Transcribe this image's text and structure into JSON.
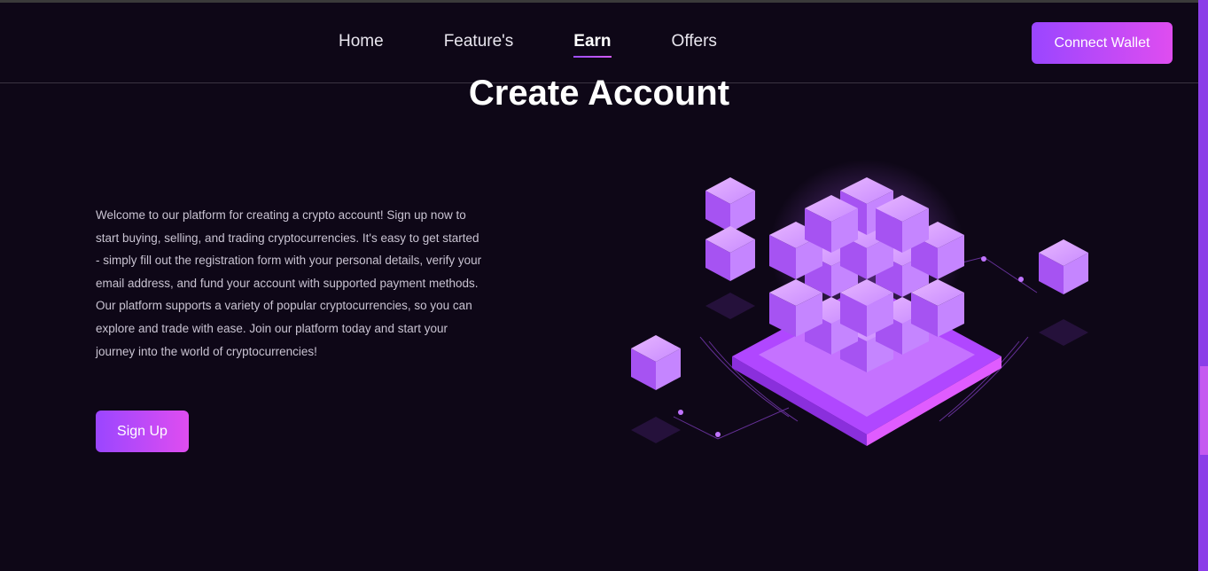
{
  "nav": {
    "links": [
      {
        "label": "Home"
      },
      {
        "label": "Feature's"
      },
      {
        "label": "Earn"
      },
      {
        "label": "Offers"
      }
    ],
    "active": "Earn",
    "connect_label": "Connect Wallet"
  },
  "hero": {
    "title": "Create Account",
    "description": "Welcome to our platform for creating a crypto account! Sign up now to start buying, selling, and trading cryptocurrencies. It's easy to get started - simply fill out the registration form with your personal details, verify your email address, and fund your account with supported payment methods. Our platform supports a variety of popular cryptocurrencies, so you can explore and trade with ease. Join our platform today and start your journey into the world of cryptocurrencies!",
    "signup_label": "Sign Up"
  },
  "illustration": {
    "icon": "blockchain-cubes-illustration"
  },
  "colors": {
    "background": "#0e0717",
    "accent_start": "#9a46ff",
    "accent_end": "#df4df0",
    "text_muted": "#c9c3d2"
  }
}
